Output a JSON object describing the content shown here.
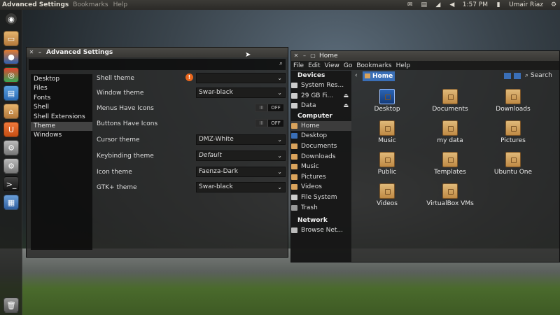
{
  "top_panel": {
    "app_title": "Advanced Settings",
    "menu": [
      "Bookmarks",
      "Help"
    ],
    "time": "1:57 PM",
    "user": "Umair Riaz"
  },
  "launcher": {
    "items": [
      "Dash home",
      "Firefox",
      "Chromium",
      "LibreOffice Writer",
      "Home Folder",
      "Ubuntu Software Center",
      "System Settings",
      "System Settings 2",
      "Terminal",
      "Workspace Switcher",
      "Trash"
    ]
  },
  "advanced_settings": {
    "title": "Advanced Settings",
    "sidebar": [
      "Desktop",
      "Files",
      "Fonts",
      "Shell",
      "Shell Extensions",
      "Theme",
      "Windows"
    ],
    "selected_index": 5,
    "rows": [
      {
        "label": "Shell theme",
        "type": "dropdown",
        "value": ""
      },
      {
        "label": "Window theme",
        "type": "dropdown",
        "value": "Swar-black"
      },
      {
        "label": "Menus Have Icons",
        "type": "toggle",
        "value": "OFF"
      },
      {
        "label": "Buttons Have Icons",
        "type": "toggle",
        "value": "OFF"
      },
      {
        "label": "Cursor theme",
        "type": "dropdown",
        "value": "DMZ-White"
      },
      {
        "label": "Keybinding theme",
        "type": "dropdown",
        "value": "Default"
      },
      {
        "label": "Icon theme",
        "type": "dropdown",
        "value": "Faenza-Dark"
      },
      {
        "label": "GTK+ theme",
        "type": "dropdown",
        "value": "Swar-black"
      }
    ],
    "warning_glyph": "!",
    "toggle_knob": "III"
  },
  "file_manager": {
    "title": "Home",
    "menu": [
      "File",
      "Edit",
      "View",
      "Go",
      "Bookmarks",
      "Help"
    ],
    "path": "Home",
    "search_label": "Search",
    "devices_header": "Devices",
    "devices": [
      "System Res...",
      "29 GB Fi...",
      "Data"
    ],
    "computer_header": "Computer",
    "computer": [
      "Home",
      "Desktop",
      "Documents",
      "Downloads",
      "Music",
      "Pictures",
      "Videos",
      "File System",
      "Trash"
    ],
    "network_header": "Network",
    "network": [
      "Browse Net..."
    ],
    "files": [
      "Desktop",
      "Documents",
      "Downloads",
      "Music",
      "my data",
      "Pictures",
      "Public",
      "Templates",
      "Ubuntu One",
      "Videos",
      "VirtualBox VMs"
    ]
  },
  "colors": {
    "accent": "#3a6fb7",
    "folder": "#d9a35c",
    "warning": "#e8661d"
  }
}
